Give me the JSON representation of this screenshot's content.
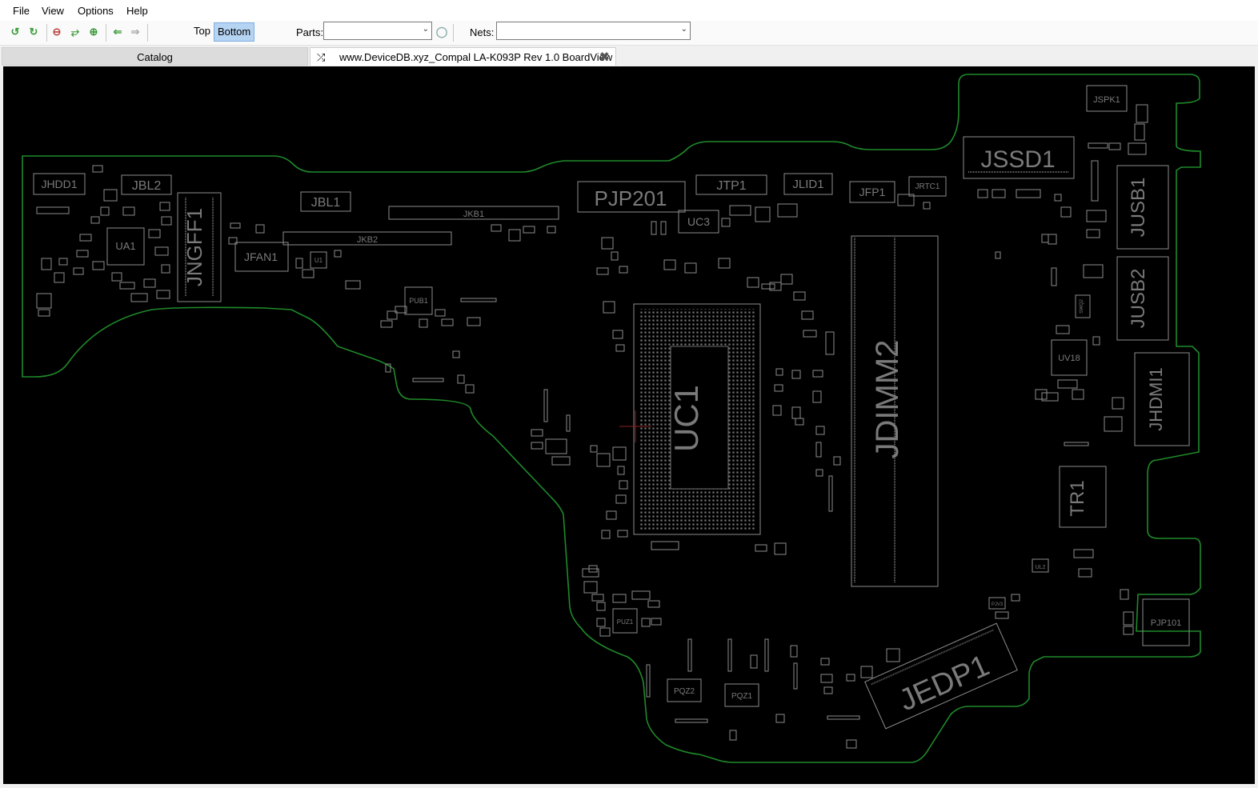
{
  "menu": {
    "file": "File",
    "view": "View",
    "options": "Options",
    "help": "Help"
  },
  "toolbar": {
    "top_label": "Top",
    "bottom_label": "Bottom",
    "parts_label": "Parts:",
    "nets_label": "Nets:",
    "parts_value": "",
    "nets_value": ""
  },
  "tabs": {
    "catalog": "Catalog",
    "board": "www.DeviceDB.xyz_Compal LA-K093P Rev 1.0 BoardView"
  },
  "components": {
    "uc1": "UC1",
    "jdimm2": "JDIMM2",
    "jssd1": "JSSD1",
    "jedp1": "JEDP1",
    "pjp201": "PJP201",
    "jusb1": "JUSB1",
    "jusb2": "JUSB2",
    "jhdmi1": "JHDMI1",
    "tr1": "TR1",
    "jngff1": "JNGFF1",
    "jhdd1": "JHDD1",
    "jbl2": "JBL2",
    "jbl1": "JBL1",
    "jkb1": "JKB1",
    "jkb2": "JKB2",
    "jfan1": "JFAN1",
    "ua1": "UA1",
    "u1": "U1",
    "pub1": "PUB1",
    "uc3": "UC3",
    "jtp1": "JTP1",
    "jlid1": "JLID1",
    "jfp1": "JFP1",
    "jrtc1": "JRTC1",
    "jspk1": "JSPK1",
    "uv18": "UV18",
    "pjp101": "PJP101",
    "pqz2": "PQZ2",
    "pqz1": "PQZ1",
    "puz1": "PUZ1",
    "ul2": "UL2",
    "swq2": "SWQ2",
    "pjv3": "PJV3"
  },
  "colors": {
    "board_outline": "#1f8a2a",
    "silkscreen": "#8c8c8c",
    "background": "#000000",
    "active_layer": "#b5d3f2"
  }
}
